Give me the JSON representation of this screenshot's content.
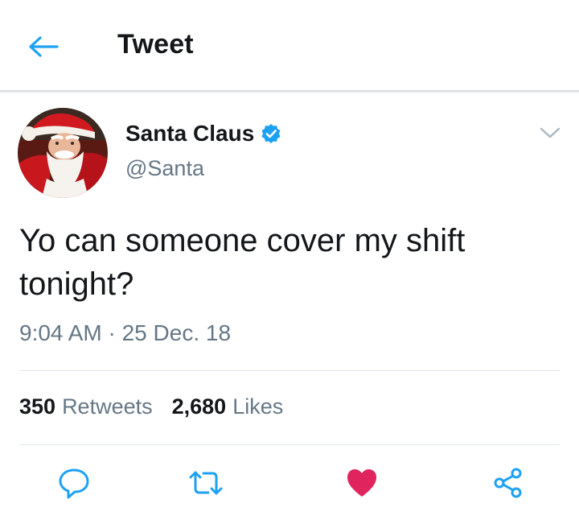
{
  "header": {
    "title": "Tweet",
    "back_icon": "arrow-left-icon"
  },
  "tweet": {
    "author": {
      "display_name": "Santa Claus",
      "handle": "@Santa",
      "verified": true
    },
    "text": "Yo can someone cover my shift tonight?",
    "timestamp": "9:04 AM · 25 Dec. 18",
    "stats": {
      "retweets_count": "350",
      "retweets_label": "Retweets",
      "likes_count": "2,680",
      "likes_label": "Likes"
    },
    "actions": [
      {
        "icon": "reply-icon"
      },
      {
        "icon": "retweet-icon"
      },
      {
        "icon": "heart-icon",
        "active": true
      },
      {
        "icon": "share-icon"
      }
    ]
  },
  "colors": {
    "accent": "#1da1f2",
    "like": "#e0245e",
    "secondary_text": "#657786",
    "primary_text": "#14171a",
    "divider": "#e1e8ed"
  }
}
